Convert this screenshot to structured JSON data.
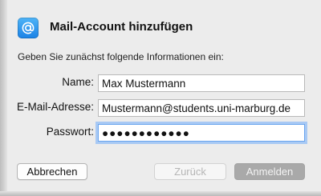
{
  "dialog": {
    "title": "Mail-Account hinzufügen",
    "intro": "Geben Sie zunächst folgende Informationen ein:",
    "icon": "at-sign-icon",
    "accent_color": "#1a82e6"
  },
  "form": {
    "name_label": "Name:",
    "name_value": "Max Mustermann",
    "email_label": "E-Mail-Adresse:",
    "email_value": "Mustermann@students.uni-marburg.de",
    "password_label": "Passwort:",
    "password_value": "●●●●●●●●●●●●"
  },
  "buttons": {
    "cancel_label": "Abbrechen",
    "back_label": "Zurück",
    "login_label": "Anmelden"
  }
}
